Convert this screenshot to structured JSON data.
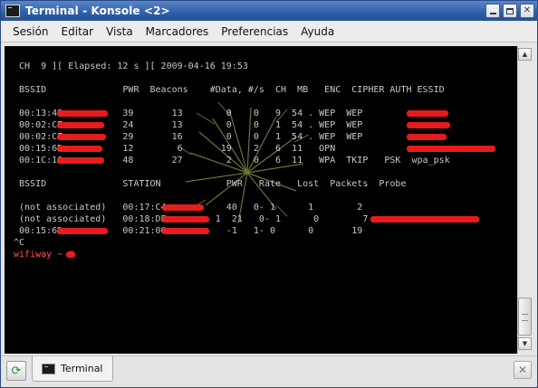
{
  "window": {
    "title": "Terminal - Konsole <2>"
  },
  "titlebar_buttons": {
    "minimize_icon": "minimize-icon",
    "maximize_icon": "maximize-icon",
    "close_label": "✕"
  },
  "menu": [
    "Sesión",
    "Editar",
    "Vista",
    "Marcadores",
    "Preferencias",
    "Ayuda"
  ],
  "terminal": {
    "lines": [
      " CH  9 ][ Elapsed: 12 s ][ 2009-04-16 19:53",
      "",
      " BSSID              PWR  Beacons    #Data, #/s  CH  MB   ENC  CIPHER AUTH ESSID",
      "",
      " 00:13:49:          39       13        0    0   9  54 . WEP  WEP",
      " 00:02:CF:          24       13        0    0   1  54 . WEP  WEP",
      " 00:02:CF:          29       16        0    0   1  54 . WEP  WEP",
      " 00:15:6D:          12        6       19    2   6  11   OPN",
      " 00:1C:10:          48       27        2    0   6  11   WPA  TKIP   PSK  wpa_psk",
      "",
      " BSSID              STATION            PWR   Rate   Lost  Packets  Probe",
      "",
      " (not associated)   00:17:C4:          40   0- 1      1        2",
      " (not associated)   00:18:DE:        1  21   0- 1      0        7",
      " 00:15:6D:          00:21:00:          -1   1- 0      0       19",
      "^C"
    ],
    "prompt_host": "wifiway",
    "prompt_rest": " ~ #"
  },
  "tabs": [
    {
      "label": "Terminal"
    }
  ],
  "tabbar": {
    "new_tab_icon": "new-tab-icon",
    "close_tab_label": "✕"
  }
}
